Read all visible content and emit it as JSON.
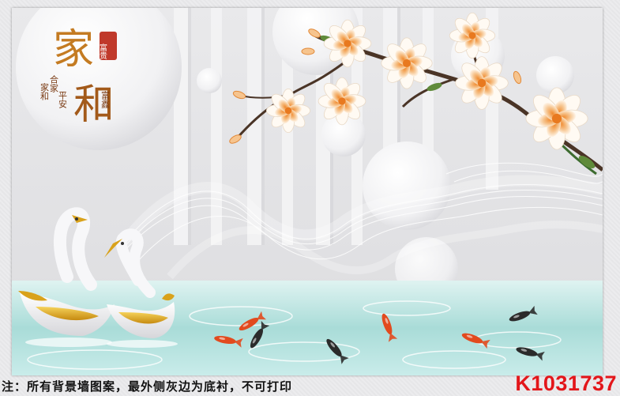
{
  "artwork": {
    "title_char_1": "家",
    "title_char_2": "和",
    "seal_text": "富贵",
    "vertical_line_1": "家和",
    "vertical_line_2": "合家",
    "vertical_line_3": "平安",
    "vertical_line_4": "富鑫",
    "colors": {
      "background": "#e4e4e6",
      "water": "#9fd6d3",
      "blossom": "#f2a65a",
      "seal": "#c0392b",
      "swan_gold": "#d9a21b"
    }
  },
  "footer": {
    "note": "注：所有背景墙图案，最外侧灰边为底衬，不可打印",
    "code": "K1031737",
    "code_color": "#e3161a"
  }
}
